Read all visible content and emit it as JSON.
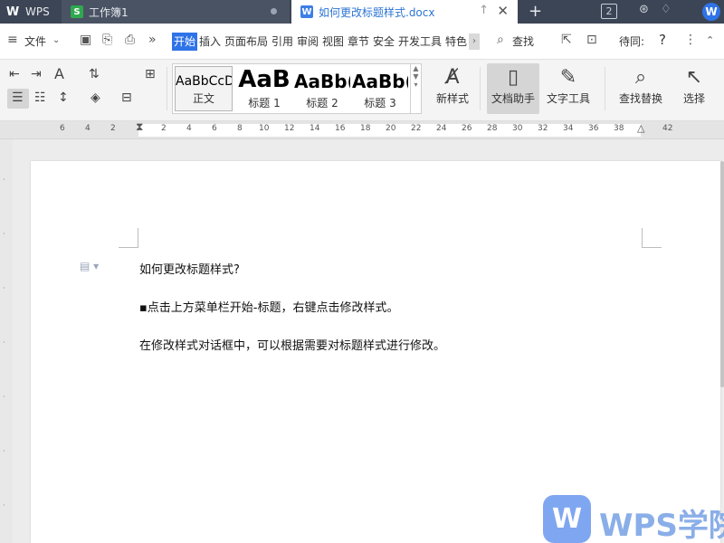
{
  "titlebar": {
    "app_label": "WPS",
    "tabs": [
      {
        "label": "工作簿1"
      },
      {
        "label": "如何更改标题样式.docx"
      }
    ],
    "window_count": "2",
    "user_initial": "W"
  },
  "menubar": {
    "file_label": "文件",
    "tabs": [
      "开始",
      "插入",
      "页面布局",
      "引用",
      "审阅",
      "视图",
      "章节",
      "安全",
      "开发工具",
      "特色"
    ],
    "search_label": "查找",
    "pending_label": "待同:",
    "help_label": "?"
  },
  "ribbon": {
    "styles": [
      {
        "sample": "AaBbCcD",
        "label": "正文"
      },
      {
        "sample": "AaB",
        "label": "标题 1"
      },
      {
        "sample": "AaBb(",
        "label": "标题 2"
      },
      {
        "sample": "AaBb(",
        "label": "标题 3"
      }
    ],
    "new_style_label": "新样式",
    "doc_assistant_label": "文档助手",
    "text_tools_label": "文字工具",
    "find_replace_label": "查找替换",
    "select_label": "选择"
  },
  "ruler": {
    "ticks": [
      "6",
      "4",
      "2",
      "2",
      "4",
      "6",
      "8",
      "10",
      "12",
      "14",
      "16",
      "18",
      "20",
      "22",
      "24",
      "26",
      "28",
      "30",
      "32",
      "34",
      "36",
      "38",
      "42"
    ]
  },
  "document": {
    "paragraphs": [
      "如何更改标题样式?",
      "▪点击上方菜单栏开始-标题，右键点击修改样式。",
      "在修改样式对话框中，可以根据需要对标题样式进行修改。"
    ]
  },
  "watermark": {
    "logo": "W",
    "text": "WPS学院"
  },
  "colors": {
    "titlebar": "#3c4555",
    "accent": "#2f73e8",
    "active_tab_text": "#2c74d4"
  }
}
